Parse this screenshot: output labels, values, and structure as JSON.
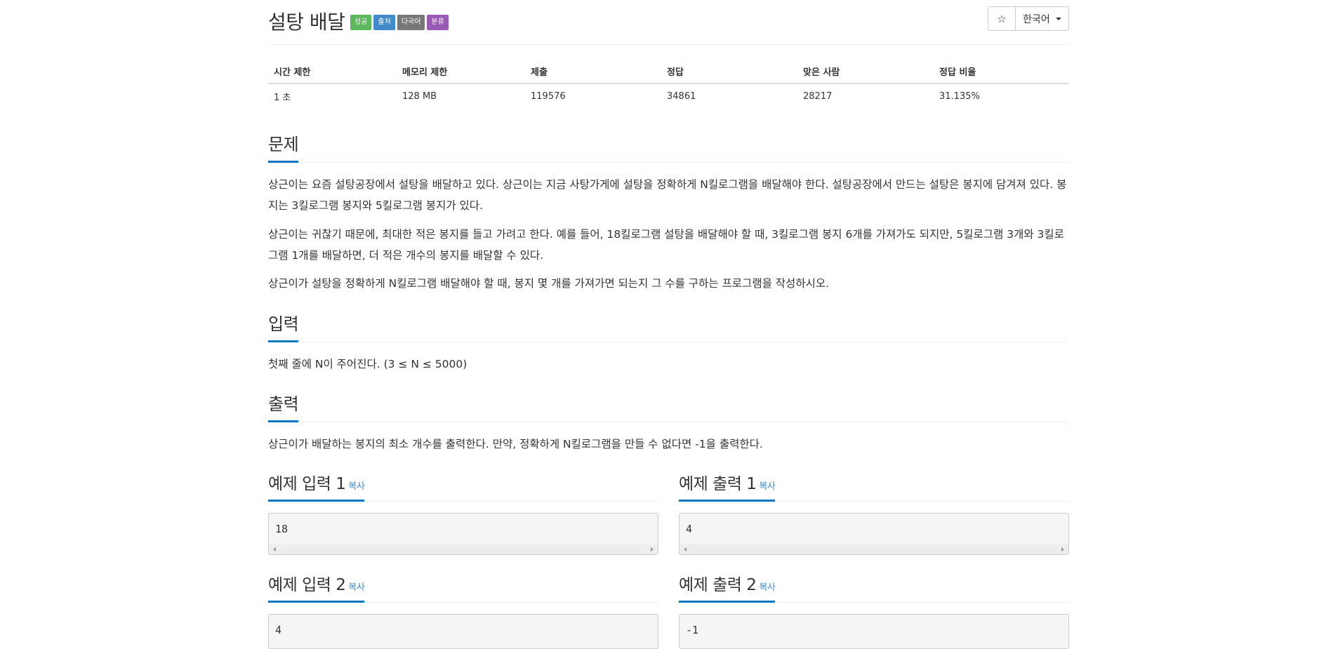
{
  "problem": {
    "title": "설탕 배달",
    "labels": [
      "성공",
      "출처",
      "다국어",
      "분류"
    ]
  },
  "header_buttons": {
    "star_icon": "☆",
    "language": "한국어"
  },
  "info_table": {
    "headers": [
      "시간 제한",
      "메모리 제한",
      "제출",
      "정답",
      "맞은 사람",
      "정답 비율"
    ],
    "values": [
      "1 초",
      "128 MB",
      "119576",
      "34861",
      "28217",
      "31.135%"
    ]
  },
  "sections": {
    "problem": {
      "heading": "문제",
      "paragraphs": [
        "상근이는 요즘 설탕공장에서 설탕을 배달하고 있다. 상근이는 지금 사탕가게에 설탕을 정확하게 N킬로그램을 배달해야 한다. 설탕공장에서 만드는 설탕은 봉지에 담겨져 있다. 봉지는 3킬로그램 봉지와 5킬로그램 봉지가 있다.",
        "상근이는 귀찮기 때문에, 최대한 적은 봉지를 들고 가려고 한다. 예를 들어, 18킬로그램 설탕을 배달해야 할 때, 3킬로그램 봉지 6개를 가져가도 되지만, 5킬로그램 3개와 3킬로그램 1개를 배달하면, 더 적은 개수의 봉지를 배달할 수 있다.",
        "상근이가 설탕을 정확하게 N킬로그램 배달해야 할 때, 봉지 몇 개를 가져가면 되는지 그 수를 구하는 프로그램을 작성하시오."
      ]
    },
    "input": {
      "heading": "입력",
      "text": "첫째 줄에 N이 주어진다. (3 ≤ N ≤ 5000)"
    },
    "output": {
      "heading": "출력",
      "text": "상근이가 배달하는 봉지의 최소 개수를 출력한다. 만약, 정확하게 N킬로그램을 만들 수 없다면 -1을 출력한다."
    }
  },
  "examples": {
    "copy_label": "복사",
    "input1": {
      "heading": "예제 입력 1",
      "code": "18"
    },
    "output1": {
      "heading": "예제 출력 1",
      "code": "4"
    },
    "input2": {
      "heading": "예제 입력 2",
      "code": "4"
    },
    "output2": {
      "heading": "예제 출력 2",
      "code": "-1"
    }
  }
}
